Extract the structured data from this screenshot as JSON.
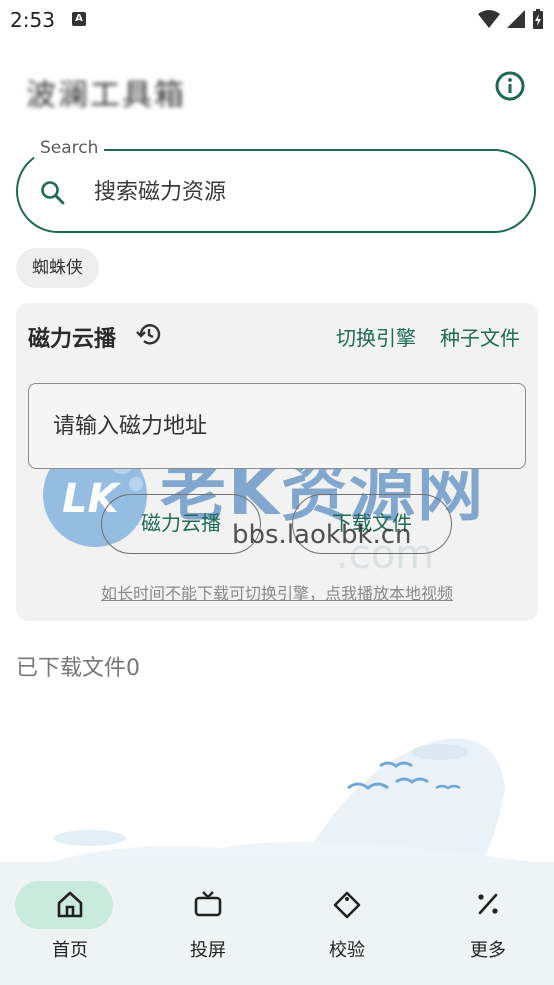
{
  "status": {
    "time": "2:53",
    "notif": "A"
  },
  "header": {
    "title": "波澜工具箱"
  },
  "search": {
    "legend": "Search",
    "placeholder": "搜索磁力资源"
  },
  "chips": [
    "蜘蛛侠"
  ],
  "card": {
    "title": "磁力云播",
    "switch_engine": "切换引擎",
    "torrent_file": "种子文件",
    "input_placeholder": "请输入磁力地址",
    "play_button": "磁力云播",
    "download_button": "下载文件",
    "hint": "如长时间不能下载可切换引擎，点我播放本地视频"
  },
  "downloaded_label": "已下载文件0",
  "watermark": {
    "text": "老K资源网",
    "url": "bbs.laokbk.cn",
    "url2": ".com",
    "logo": "LK"
  },
  "nav": [
    {
      "label": "首页",
      "icon": "home-icon"
    },
    {
      "label": "投屏",
      "icon": "tv-icon"
    },
    {
      "label": "校验",
      "icon": "tag-icon"
    },
    {
      "label": "更多",
      "icon": "percent-icon"
    }
  ],
  "colors": {
    "accent": "#1e6a55",
    "nav_bg": "#eef3f3",
    "nav_active": "#c8ebde",
    "card_bg": "#f2f2f2"
  }
}
